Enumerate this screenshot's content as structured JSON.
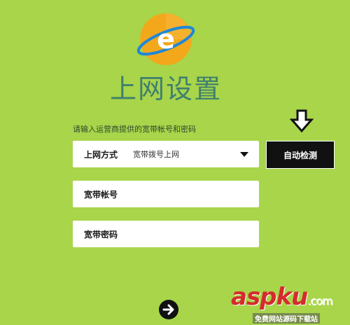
{
  "logo": {
    "letter": "e"
  },
  "title": "上网设置",
  "instruction": "请输入运营商提供的宽带帐号和密码",
  "connection": {
    "label": "上网方式",
    "value": "宽带拨号上网"
  },
  "account": {
    "label": "宽带帐号"
  },
  "password": {
    "label": "宽带密码"
  },
  "detect_button": "自动检测",
  "watermark": {
    "brand": "aspku",
    "suffix": ".com",
    "tagline": "免费网站源码下载站"
  },
  "colors": {
    "background": "#a8d54a",
    "title": "#3f7f6e",
    "button": "#111111",
    "logo_orange": "#f3a81c"
  }
}
